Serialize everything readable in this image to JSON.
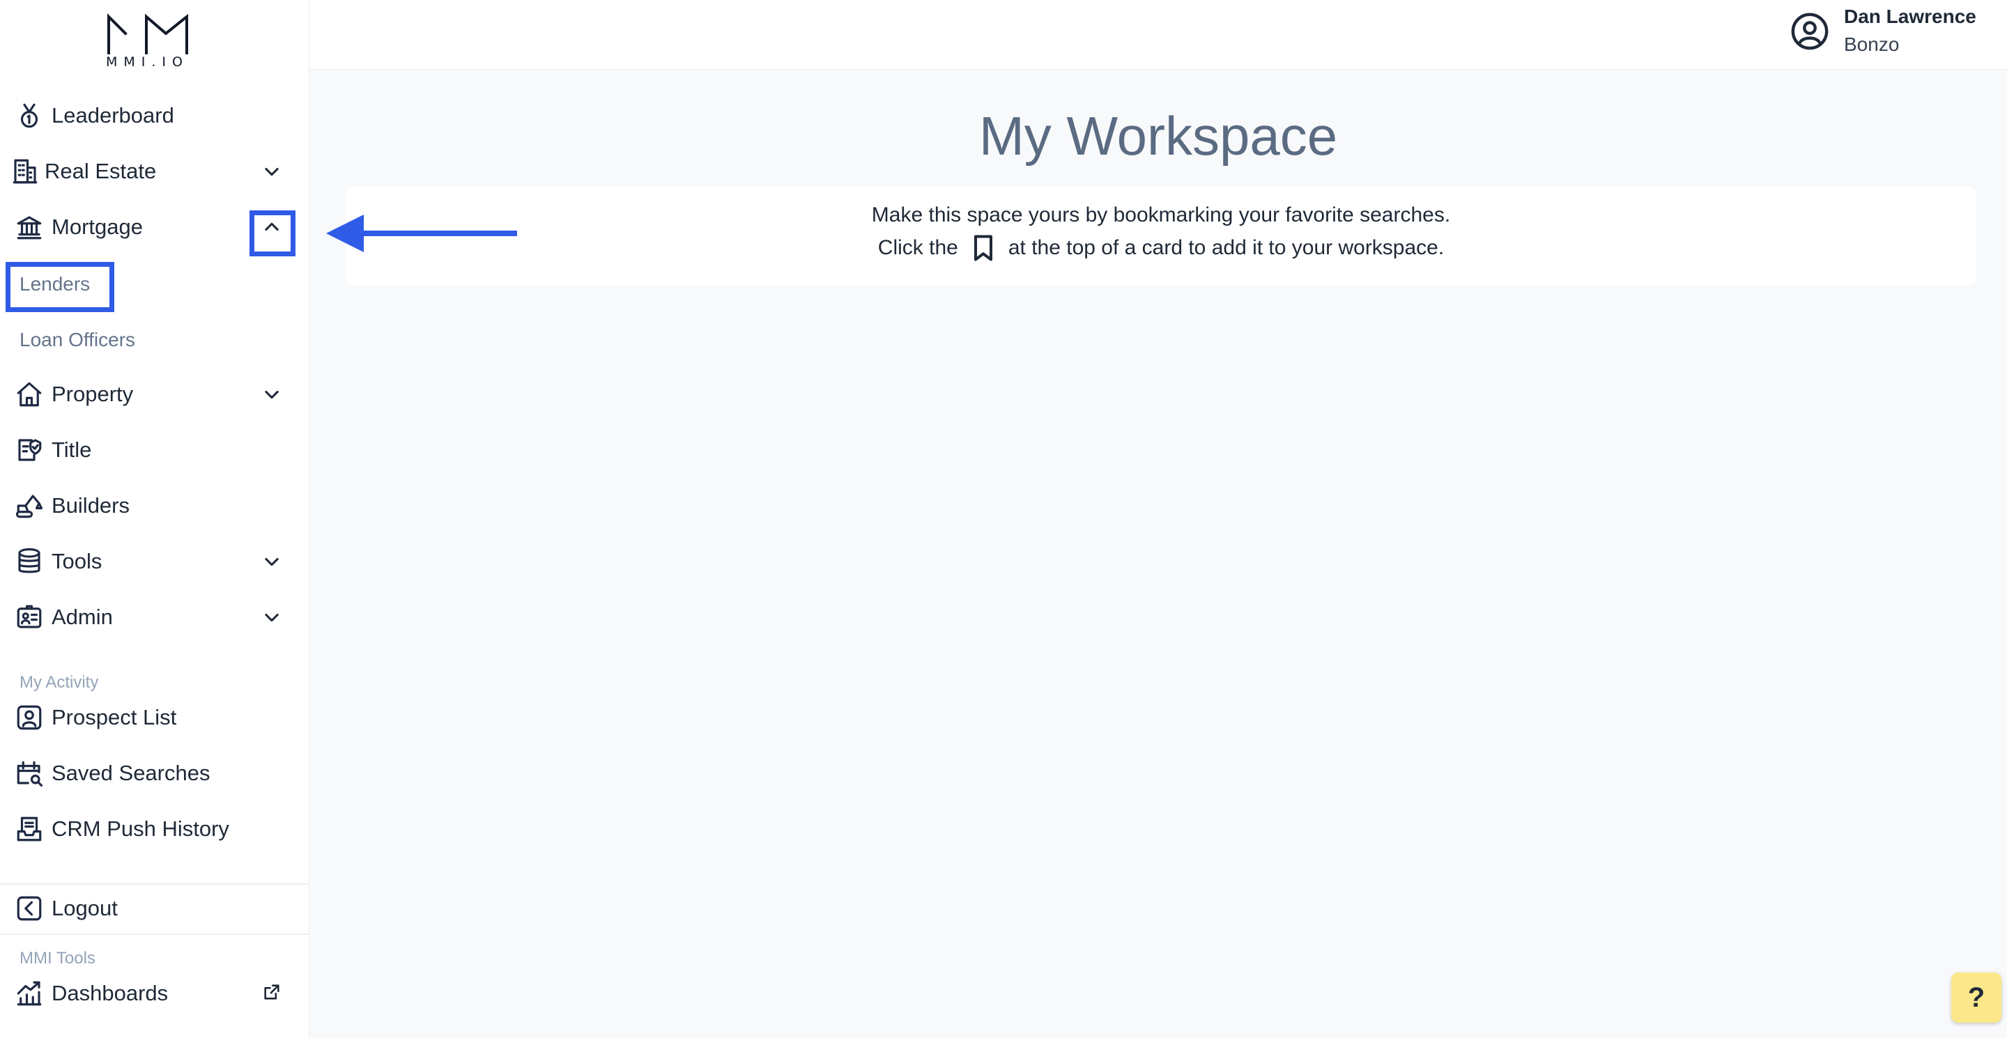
{
  "brand": {
    "logo_text": "MMI.IO"
  },
  "sidebar": {
    "items": [
      {
        "label": "Leaderboard",
        "icon": "medal-icon"
      },
      {
        "label": "Real Estate",
        "icon": "building-icon",
        "chevron": "down"
      },
      {
        "label": "Mortgage",
        "icon": "bank-icon",
        "chevron": "up"
      },
      {
        "label": "Property",
        "icon": "house-icon",
        "chevron": "down"
      },
      {
        "label": "Title",
        "icon": "title-check-icon"
      },
      {
        "label": "Builders",
        "icon": "excavator-icon"
      },
      {
        "label": "Tools",
        "icon": "database-icon",
        "chevron": "down"
      },
      {
        "label": "Admin",
        "icon": "id-card-icon",
        "chevron": "down"
      }
    ],
    "mortgage_sub": [
      {
        "label": "Lenders"
      },
      {
        "label": "Loan Officers"
      }
    ],
    "activity_label": "My Activity",
    "activity_items": [
      {
        "label": "Prospect List",
        "icon": "contact-icon"
      },
      {
        "label": "Saved Searches",
        "icon": "calendar-search-icon"
      },
      {
        "label": "CRM Push History",
        "icon": "inbox-icon"
      }
    ],
    "logout_label": "Logout",
    "tools_label": "MMI Tools",
    "dashboards_label": "Dashboards"
  },
  "header": {
    "user_name": "Dan Lawrence",
    "user_org": "Bonzo"
  },
  "main": {
    "title": "My Workspace",
    "info_line1": "Make this space yours by bookmarking your favorite searches.",
    "info_line2_before": "Click the",
    "info_line2_after": "at the top of a card to add it to your workspace."
  },
  "help": {
    "label": "?"
  },
  "colors": {
    "annotation": "#2f5be6",
    "help_bg": "#fce88a",
    "title": "#5a6b82"
  }
}
